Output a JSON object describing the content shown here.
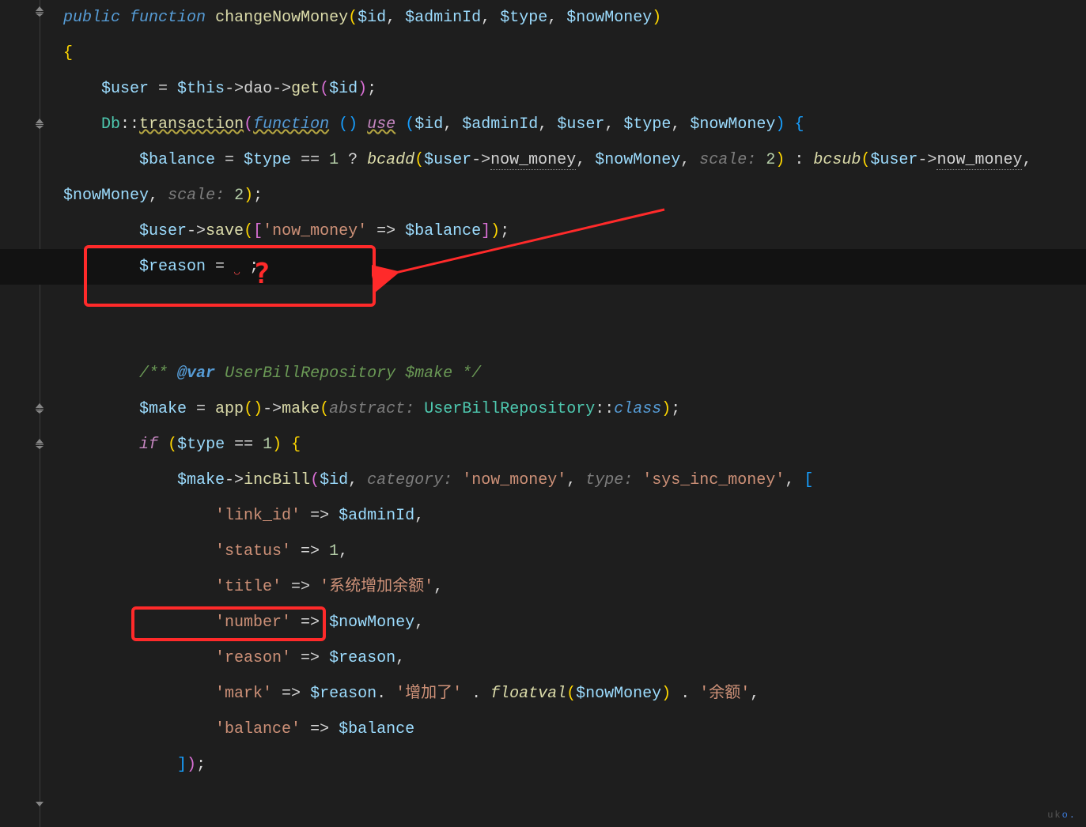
{
  "code": {
    "fn_public": "public",
    "fn_function": "function",
    "fn_name": "changeNowMoney",
    "params": {
      "id": "$id",
      "adminId": "$adminId",
      "type": "$type",
      "nowMoney": "$nowMoney",
      "user": "$user",
      "balance": "$balance",
      "reason": "$reason",
      "make": "$make",
      "this": "$this"
    },
    "methods": {
      "dao": "dao",
      "get": "get",
      "Db": "Db",
      "transaction": "transaction",
      "use": "use",
      "bcadd": "bcadd",
      "bcsub": "bcsub",
      "now_money_prop": "now_money",
      "save": "save",
      "app": "app",
      "make": "make",
      "incBill": "incBill",
      "floatval": "floatval",
      "class": "class"
    },
    "hints": {
      "scale": "scale:",
      "abstract": "abstract:",
      "category": "category:",
      "type": "type:"
    },
    "strings": {
      "now_money": "'now_money'",
      "sys_inc_money": "'sys_inc_money'",
      "link_id": "'link_id'",
      "status": "'status'",
      "title": "'title'",
      "title_val": "'系统增加余额'",
      "number": "'number'",
      "reason": "'reason'",
      "mark": "'mark'",
      "mark_add": "'增加了'",
      "mark_bal": "'余额'",
      "balance": "'balance'"
    },
    "numbers": {
      "one": "1",
      "two": "2"
    },
    "repo": "UserBillRepository",
    "docvar": "@var",
    "comment_prefix": "/** ",
    "comment_suffix": " */",
    "if": "if",
    "arrow": "->",
    "dblcolon": "::",
    "comma": ",",
    "fat_arrow": " => ",
    "eq": " = ",
    "eqeq": " == ",
    "qmark": " ? ",
    "colon": " : ",
    "semi": ";",
    "dot": " . ",
    "brace_open": "{",
    "brace_close": "}",
    "paren_open": "(",
    "paren_close": ")",
    "bracket_open": "[",
    "bracket_close": "]",
    "bracket_close_paren_semi": "]);",
    "paren_close_semi": ");",
    "space": " ",
    "squiggle": "◡"
  },
  "annotation": {
    "question_mark": "?"
  },
  "watermark": {
    "text": "uk",
    "blue": "o"
  }
}
